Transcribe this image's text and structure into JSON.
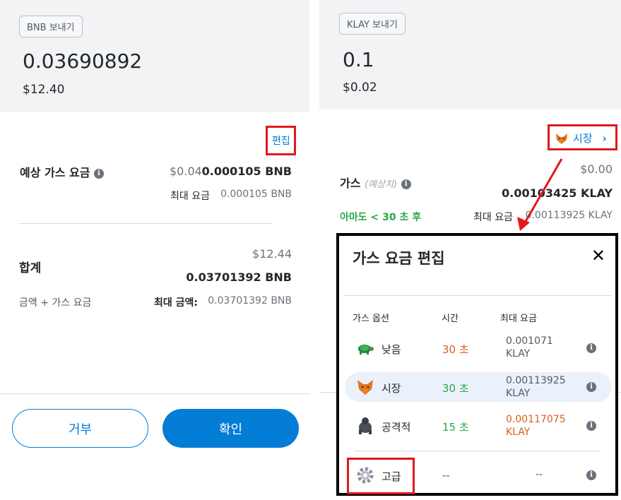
{
  "left_screen": {
    "send_chip": "BNB 보내기",
    "amount": "0.03690892",
    "fiat": "$12.40",
    "edit_link": "편집",
    "gas_label": "예상 가스 요금",
    "gas_fiat": "$0.04",
    "gas_crypto": "0.000105 BNB",
    "max_fee_label": "최대 요금",
    "max_fee_value": "0.000105 BNB",
    "total_label": "합계",
    "total_fiat": "$12.44",
    "total_crypto": "0.03701392 BNB",
    "amount_plus_gas": "금액 + 가스 요금",
    "max_amount_label": "최대 금액:",
    "max_amount_value": "0.03701392 BNB",
    "reject_button": "거부",
    "confirm_button": "확인"
  },
  "right_screen": {
    "send_chip": "KLAY 보내기",
    "amount": "0.1",
    "fiat": "$0.02",
    "market_link": "시장",
    "gas_label": "가스",
    "gas_estimate": "(예상치)",
    "gas_fiat": "$0.00",
    "gas_crypto": "0.00103425 KLAY",
    "likely_text": "아마도 < 30 초 후",
    "max_fee_label": "최대 요금",
    "max_fee_value": "0.00113925 KLAY"
  },
  "modal": {
    "title": "가스 요금 편집",
    "col_option": "가스 옵션",
    "col_time": "시간",
    "col_max_fee": "최대 요금",
    "options": [
      {
        "label": "낮음",
        "time": "30 초",
        "fee_line1": "0.001071",
        "fee_line2": "KLAY",
        "icon": "turtle-icon"
      },
      {
        "label": "시장",
        "time": "30 초",
        "fee_line1": "0.00113925",
        "fee_line2": "KLAY",
        "icon": "fox-icon"
      },
      {
        "label": "공격적",
        "time": "15 초",
        "fee_line1": "0.00117075",
        "fee_line2": "KLAY",
        "icon": "gorilla-icon"
      }
    ],
    "advanced": {
      "label": "고급",
      "time": "--",
      "fee": "--",
      "icon": "gear-icon"
    }
  },
  "colors": {
    "accent": "#037dd6",
    "highlight": "#e0181f",
    "orange": "#d9601a",
    "green": "#28a745"
  }
}
